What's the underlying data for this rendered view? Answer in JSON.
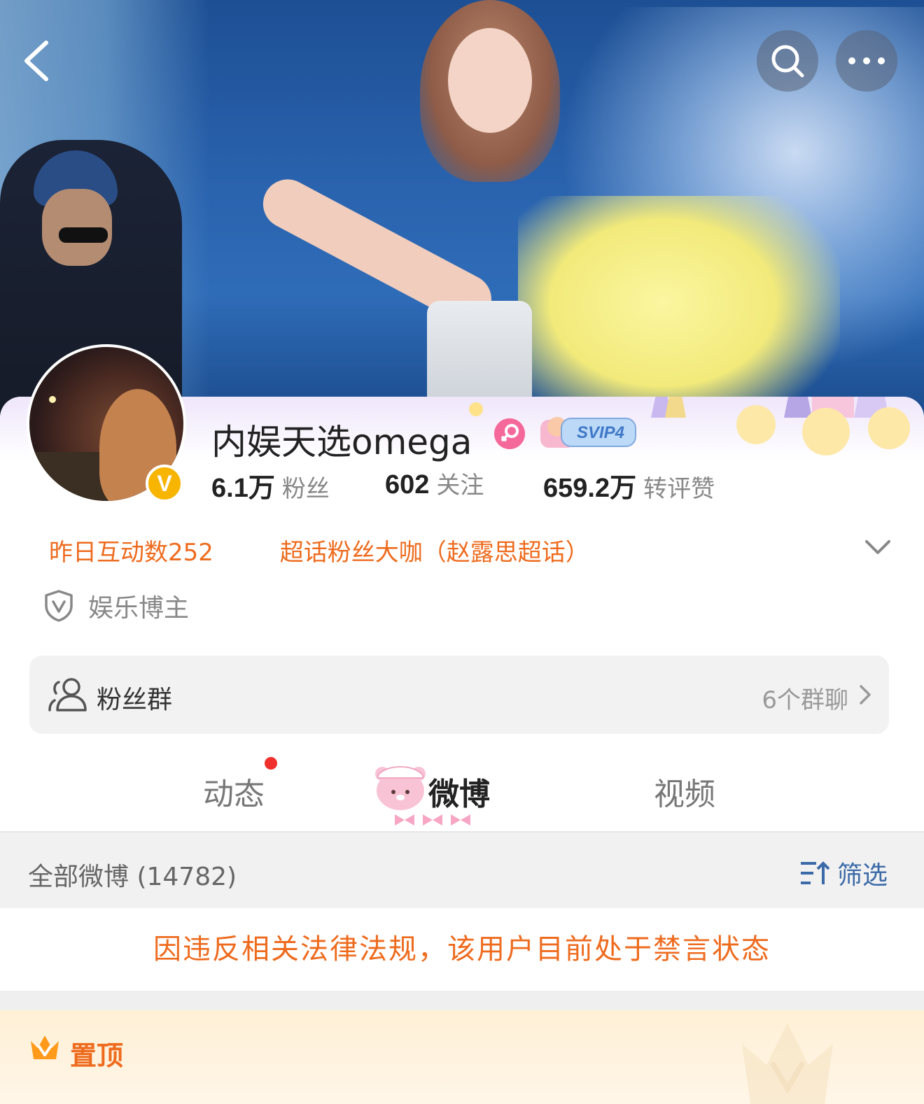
{
  "header": {
    "back_icon": "chevron-left-icon",
    "search_icon": "search-icon",
    "more_icon": "more-dots-icon"
  },
  "profile": {
    "username": "内娱天选omega",
    "gender_icon": "female-icon",
    "membership_badge": "SVIP4",
    "verified_mark": "V",
    "stats": [
      {
        "value": "6.1万",
        "label": "粉丝"
      },
      {
        "value": "602",
        "label": "关注"
      },
      {
        "value": "659.2万",
        "label": "转评赞"
      }
    ],
    "interaction": "昨日互动数252",
    "super_topic": "超话粉丝大咖（赵露思超话）",
    "tag": "娱乐博主"
  },
  "fans_group": {
    "label": "粉丝群",
    "count": "6个群聊"
  },
  "tabs": [
    {
      "label": "动态",
      "has_dot": true
    },
    {
      "label": "微博",
      "active": true
    },
    {
      "label": "视频"
    }
  ],
  "feed": {
    "count_label": "全部微博 (14782)",
    "filter_label": "筛选",
    "notice": "因违反相关法律法规，该用户目前处于禁言状态",
    "pinned_label": "置顶"
  },
  "colors": {
    "accent_orange": "#ee6b1e",
    "link_blue": "#3c6aa8",
    "verified_gold": "#f7b500",
    "gender_pink": "#f5699a",
    "dot_red": "#f0302c"
  }
}
